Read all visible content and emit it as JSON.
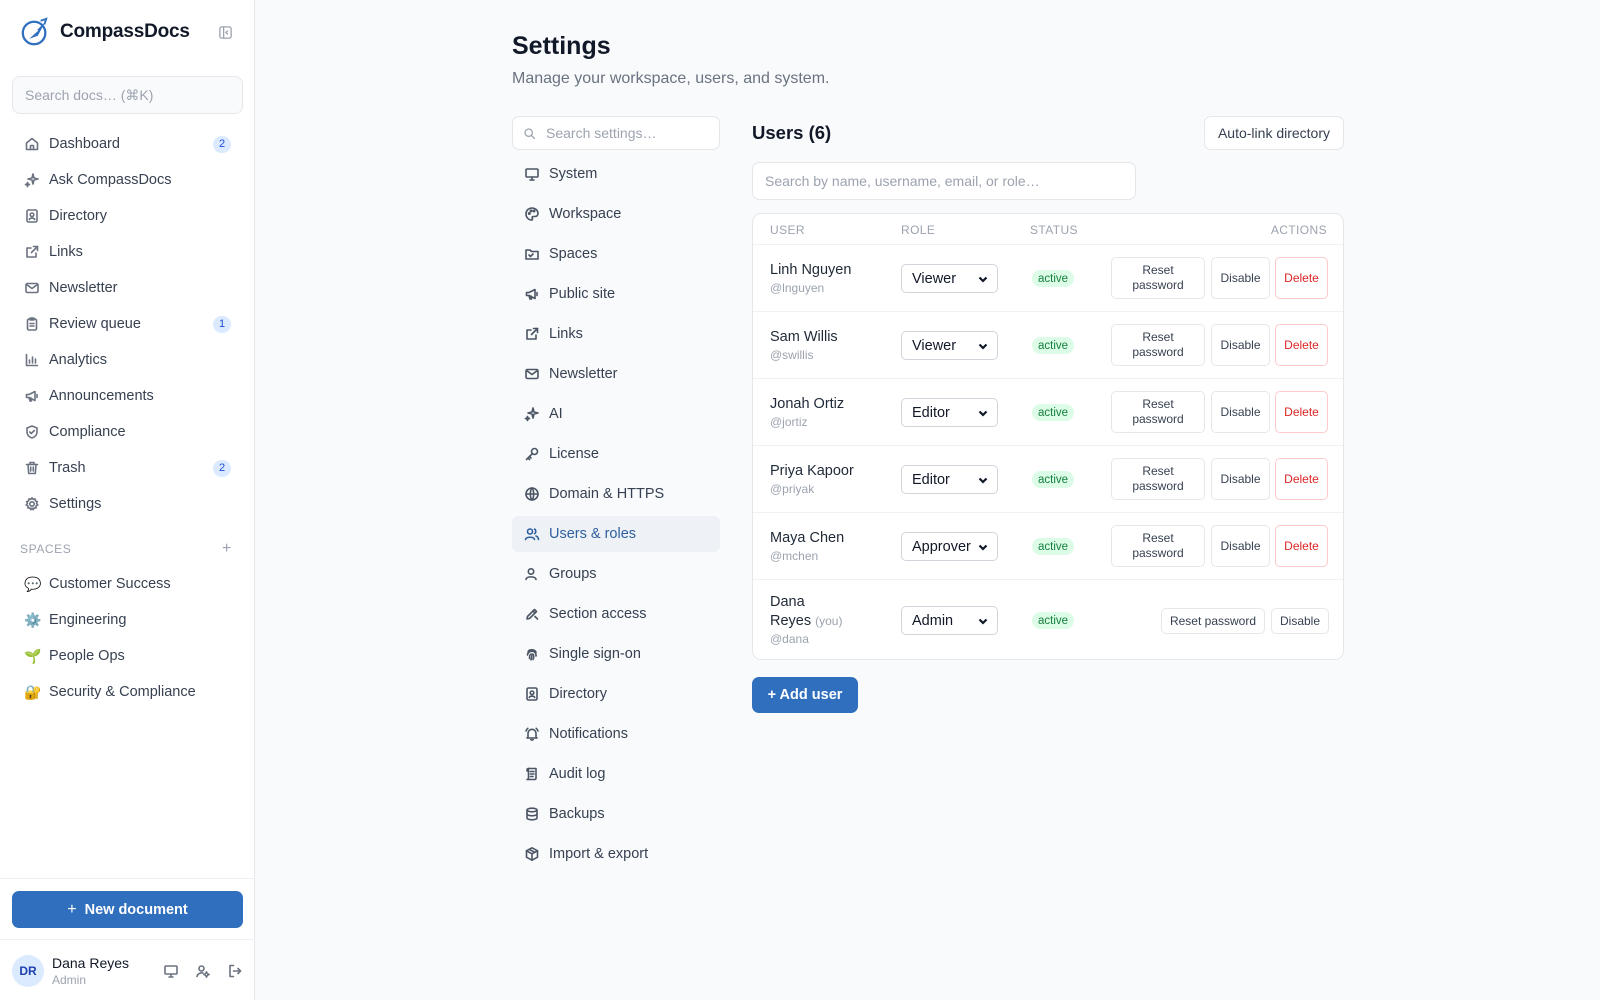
{
  "app": {
    "name": "CompassDocs"
  },
  "sidebar": {
    "search_placeholder": "Search docs… (⌘K)",
    "items": [
      {
        "label": "Dashboard",
        "icon": "home-icon",
        "badge": "2"
      },
      {
        "label": "Ask CompassDocs",
        "icon": "sparkles-icon",
        "badge": ""
      },
      {
        "label": "Directory",
        "icon": "contact-book-icon",
        "badge": ""
      },
      {
        "label": "Links",
        "icon": "external-link-icon",
        "badge": ""
      },
      {
        "label": "Newsletter",
        "icon": "mail-icon",
        "badge": ""
      },
      {
        "label": "Review queue",
        "icon": "clipboard-icon",
        "badge": "1"
      },
      {
        "label": "Analytics",
        "icon": "bar-chart-icon",
        "badge": ""
      },
      {
        "label": "Announcements",
        "icon": "megaphone-icon",
        "badge": ""
      },
      {
        "label": "Compliance",
        "icon": "shield-check-icon",
        "badge": ""
      },
      {
        "label": "Trash",
        "icon": "trash-icon",
        "badge": "2"
      },
      {
        "label": "Settings",
        "icon": "gear-icon",
        "badge": ""
      }
    ],
    "spaces_header": "SPACES",
    "spaces_add": "+",
    "spaces": [
      {
        "emoji": "💬",
        "label": "Customer Success"
      },
      {
        "emoji": "⚙️",
        "label": "Engineering"
      },
      {
        "emoji": "🌱",
        "label": "People Ops"
      },
      {
        "emoji": "🔐",
        "label": "Security & Compliance"
      }
    ],
    "new_document": "New document",
    "new_document_plus": "+",
    "user": {
      "initials": "DR",
      "name": "Dana Reyes",
      "role": "Admin"
    }
  },
  "main": {
    "title": "Settings",
    "subtitle": "Manage your workspace, users, and system.",
    "settings_search_placeholder": "Search settings…",
    "settings_nav": [
      {
        "label": "System",
        "icon": "monitor-icon"
      },
      {
        "label": "Workspace",
        "icon": "palette-icon"
      },
      {
        "label": "Spaces",
        "icon": "folder-icon"
      },
      {
        "label": "Public site",
        "icon": "megaphone-icon"
      },
      {
        "label": "Links",
        "icon": "external-link-icon"
      },
      {
        "label": "Newsletter",
        "icon": "mail-icon"
      },
      {
        "label": "AI",
        "icon": "sparkles-icon"
      },
      {
        "label": "License",
        "icon": "key-icon"
      },
      {
        "label": "Domain & HTTPS",
        "icon": "globe-icon"
      },
      {
        "label": "Users & roles",
        "icon": "users-icon",
        "active": true
      },
      {
        "label": "Groups",
        "icon": "user-group-icon"
      },
      {
        "label": "Section access",
        "icon": "pencil-lock-icon"
      },
      {
        "label": "Single sign-on",
        "icon": "fingerprint-icon"
      },
      {
        "label": "Directory",
        "icon": "contact-book-icon"
      },
      {
        "label": "Notifications",
        "icon": "bell-icon"
      },
      {
        "label": "Audit log",
        "icon": "scroll-icon"
      },
      {
        "label": "Backups",
        "icon": "database-icon"
      },
      {
        "label": "Import & export",
        "icon": "package-icon"
      }
    ],
    "users_title": "Users (6)",
    "autolink_label": "Auto-link directory",
    "user_search_placeholder": "Search by name, username, email, or role…",
    "table_headers": {
      "user": "USER",
      "role": "ROLE",
      "status": "STATUS",
      "actions": "ACTIONS"
    },
    "users": [
      {
        "name": "Linh Nguyen",
        "handle": "@lnguyen",
        "role": "Viewer",
        "status": "active"
      },
      {
        "name": "Sam Willis",
        "handle": "@swillis",
        "role": "Viewer",
        "status": "active"
      },
      {
        "name": "Jonah Ortiz",
        "handle": "@jortiz",
        "role": "Editor",
        "status": "active"
      },
      {
        "name": "Priya Kapoor",
        "handle": "@priyak",
        "role": "Editor",
        "status": "active"
      },
      {
        "name": "Maya Chen",
        "handle": "@mchen",
        "role": "Approver",
        "status": "active"
      }
    ],
    "self_user": {
      "name_line1": "Dana",
      "name_line2": "Reyes",
      "you": "(you)",
      "handle": "@dana",
      "role": "Admin",
      "status": "active"
    },
    "actions": {
      "reset_line1": "Reset",
      "reset_line2": "password",
      "reset_full": "Reset password",
      "disable": "Disable",
      "delete": "Delete"
    },
    "add_user": "+ Add user"
  },
  "colors": {
    "accent": "#2f6fbe",
    "active_nav_bg": "#eef2f7",
    "status_bg": "#dcfce7",
    "status_text": "#15803d",
    "danger": "#dc2626"
  }
}
